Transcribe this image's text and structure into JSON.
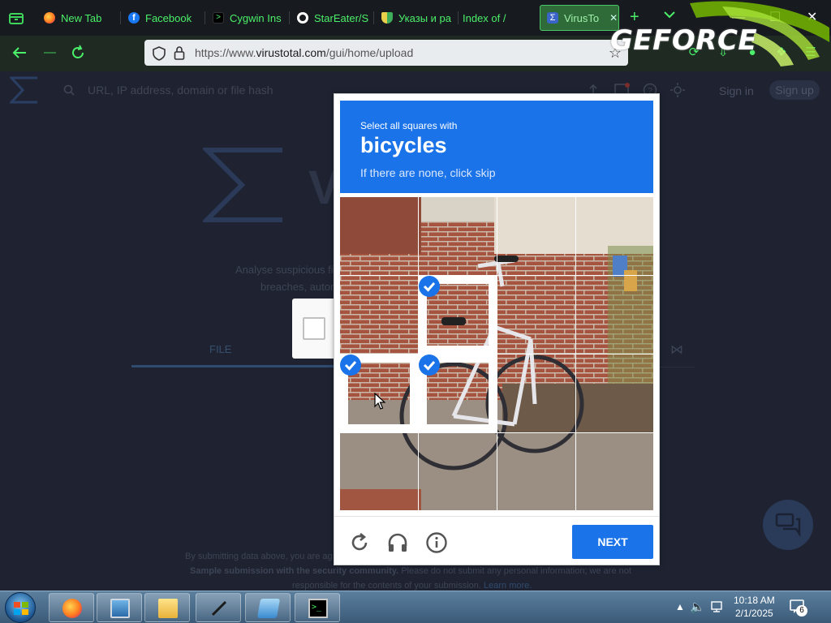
{
  "browser": {
    "tabs": [
      {
        "title": "New Tab",
        "icon": "firefox-icon",
        "active": false
      },
      {
        "title": "Facebook",
        "icon": "facebook-icon",
        "active": false
      },
      {
        "title": "Cygwin Ins",
        "icon": "cygwin-icon",
        "active": false
      },
      {
        "title": "StarEater/S",
        "icon": "github-icon",
        "active": false
      },
      {
        "title": "Указы и ра",
        "icon": "document-shield-icon",
        "active": false
      },
      {
        "title": "Index of /",
        "icon": "",
        "active": false
      },
      {
        "title": "VirusTo",
        "icon": "virustotal-icon",
        "active": true
      }
    ],
    "new_tab_symbol": "+",
    "url_prefix": "https://www.",
    "url_domain": "virustotal.com",
    "url_path": "/gui/home/upload",
    "accent_color": "#4bf06a"
  },
  "overlay": {
    "geforce_text": "GEFORCE"
  },
  "virustotal": {
    "search_placeholder": "URL, IP address, domain or file hash",
    "sign_in": "Sign in",
    "sign_up": "Sign up",
    "desc_line1": "Analyse suspicious fi",
    "desc_line2": "breaches, autor",
    "file_tab": "FILE",
    "footer_line1": "By submitting data above, you are ag",
    "footer_line2_bold": "Sample submission with the security community.",
    "footer_line2_rest": " Please do not submit any personal information; we are not",
    "footer_line3": "responsible for the contents of your submission.",
    "footer_link": "Learn more."
  },
  "captcha": {
    "instruction_prefix": "Select all squares with",
    "target": "bicycles",
    "instruction_suffix": "If there are none, click skip",
    "selected_tiles": [
      5,
      8,
      9
    ],
    "next_label": "NEXT",
    "brand_blue": "#1a73e8"
  },
  "taskbar": {
    "time": "10:18 AM",
    "date": "2/1/2025",
    "notification_count": "6"
  }
}
